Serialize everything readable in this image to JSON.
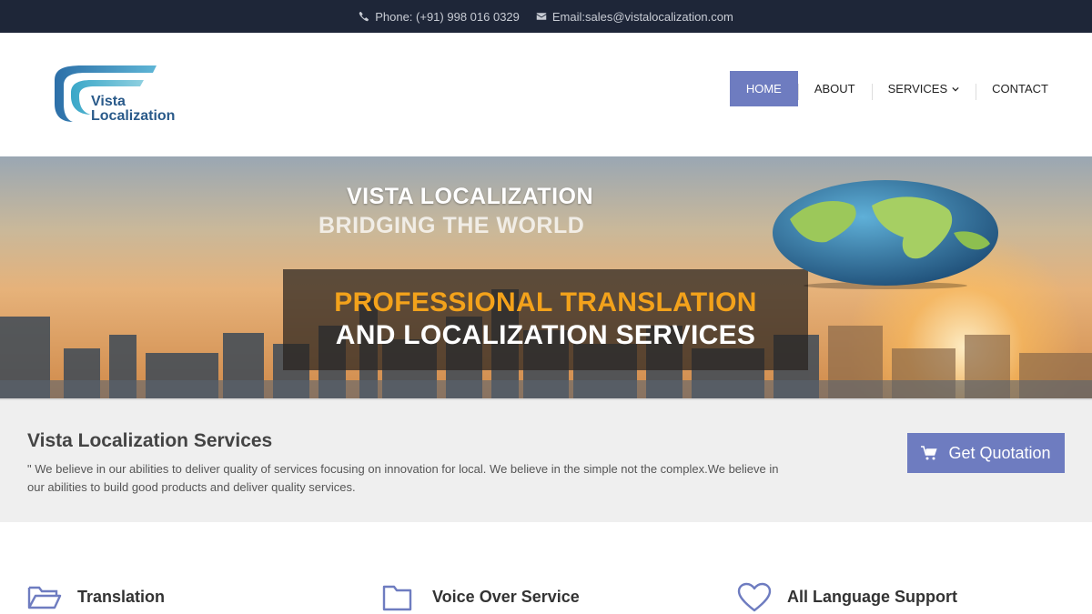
{
  "topbar": {
    "phone": "Phone: (+91) 998 016 0329",
    "email": "Email:sales@vistalocalization.com"
  },
  "logo": {
    "line1": "Vista",
    "line2": "Localization"
  },
  "nav": {
    "items": [
      {
        "label": "HOME"
      },
      {
        "label": "ABOUT"
      },
      {
        "label": "SERVICES"
      },
      {
        "label": "CONTACT"
      }
    ]
  },
  "hero": {
    "title": "VISTA LOCALIZATION",
    "subtitle": "BRIDGING THE WORLD",
    "banner_line1": "PROFESSIONAL TRANSLATION",
    "banner_line2": "AND LOCALIZATION SERVICES"
  },
  "intro": {
    "title": "Vista Localization Services",
    "text": "\" We believe in our abilities to deliver quality of services focusing on innovation for local. We believe in the simple not the complex.We believe in our abilities to build good products and deliver quality services.",
    "button": "Get Quotation"
  },
  "features": [
    {
      "title": "Translation",
      "icon": "folder-open-icon"
    },
    {
      "title": "Voice Over Service",
      "icon": "folder-icon"
    },
    {
      "title": "All Language Support",
      "icon": "heart-icon"
    }
  ],
  "colors": {
    "topbar_bg": "#1e2638",
    "accent": "#6e7cc0",
    "banner_orange": "#f3a21b"
  }
}
